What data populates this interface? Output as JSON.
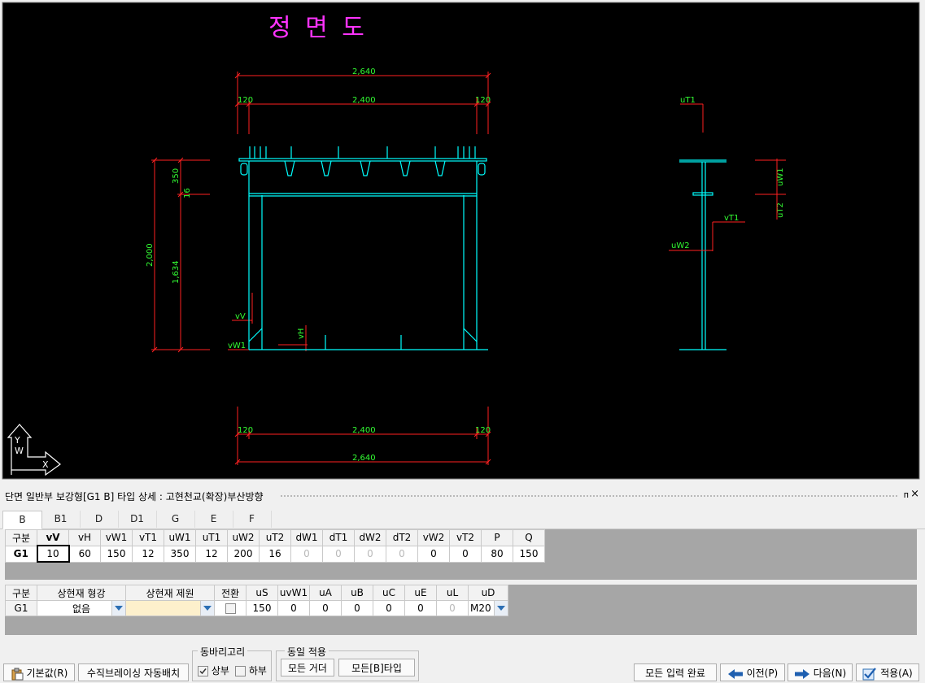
{
  "drawing": {
    "title": "정 면 도",
    "dims": {
      "top_total": "2,640",
      "top_left": "120",
      "top_mid": "2,400",
      "top_right": "120",
      "bot_left": "120",
      "bot_mid": "2,400",
      "bot_right": "120",
      "bot_total": "2,640",
      "h_total": "2,000",
      "h_upper": "350",
      "h_flange": "16",
      "h_lower": "1,634"
    },
    "labels": {
      "vV": "vV",
      "vW1": "vW1",
      "vH": "vH",
      "uT1": "uT1",
      "uW1": "uW1",
      "uT2": "uT2",
      "vT1": "vT1",
      "uW2": "uW2"
    },
    "axis": {
      "y": "Y",
      "w": "W",
      "x": "X"
    }
  },
  "panel": {
    "title": "단면 일반부 보강형[G1 B] 타입 상세 : 고현천교(확장)부산방향",
    "pin": "ᴨ",
    "close": "×"
  },
  "tabs": [
    "B",
    "B1",
    "D",
    "D1",
    "G",
    "E",
    "F"
  ],
  "grid1": {
    "headers": [
      "구분",
      "vV",
      "vH",
      "vW1",
      "vT1",
      "uW1",
      "uT1",
      "uW2",
      "uT2",
      "dW1",
      "dT1",
      "dW2",
      "dT2",
      "vW2",
      "vT2",
      "P",
      "Q"
    ],
    "rows": [
      {
        "label": "G1",
        "values": [
          "10",
          "60",
          "150",
          "12",
          "350",
          "12",
          "200",
          "16",
          "0",
          "0",
          "0",
          "0",
          "0",
          "0",
          "80",
          "150"
        ]
      }
    ]
  },
  "grid2": {
    "headers": [
      "구분",
      "상현재 형강",
      "상현재 제원",
      "전환",
      "uS",
      "uvW1",
      "uA",
      "uB",
      "uC",
      "uE",
      "uL",
      "uD"
    ],
    "rows": [
      {
        "label": "G1",
        "shape": "없음",
        "spec": "",
        "uS": "150",
        "uvW1": "0",
        "uA": "0",
        "uB": "0",
        "uC": "0",
        "uE": "0",
        "uL": "0",
        "uD": "M20"
      }
    ]
  },
  "bottom": {
    "default_btn": "기본값(R)",
    "auto_brace_btn": "수직브레이싱 자동배치",
    "group_hook": {
      "legend": "동바리고리",
      "upper": "상부",
      "lower": "하부"
    },
    "group_same": {
      "legend": "동일 적용",
      "all_girder": "모든 거더",
      "all_btype": "모든[B]타입"
    },
    "complete_btn": "모든 입력 완료",
    "prev_btn": "이전(P)",
    "next_btn": "다음(N)",
    "apply_btn": "적용(A)"
  },
  "colors": {
    "cad_bg": "#000000",
    "title_magenta": "#ff33ff",
    "dim_red": "#ff2020",
    "dim_text_green": "#33ff33",
    "structure_cyan": "#00ffff",
    "disabled_cell": "#fdf0cc",
    "arrow_blue": "#2c6fb4"
  }
}
